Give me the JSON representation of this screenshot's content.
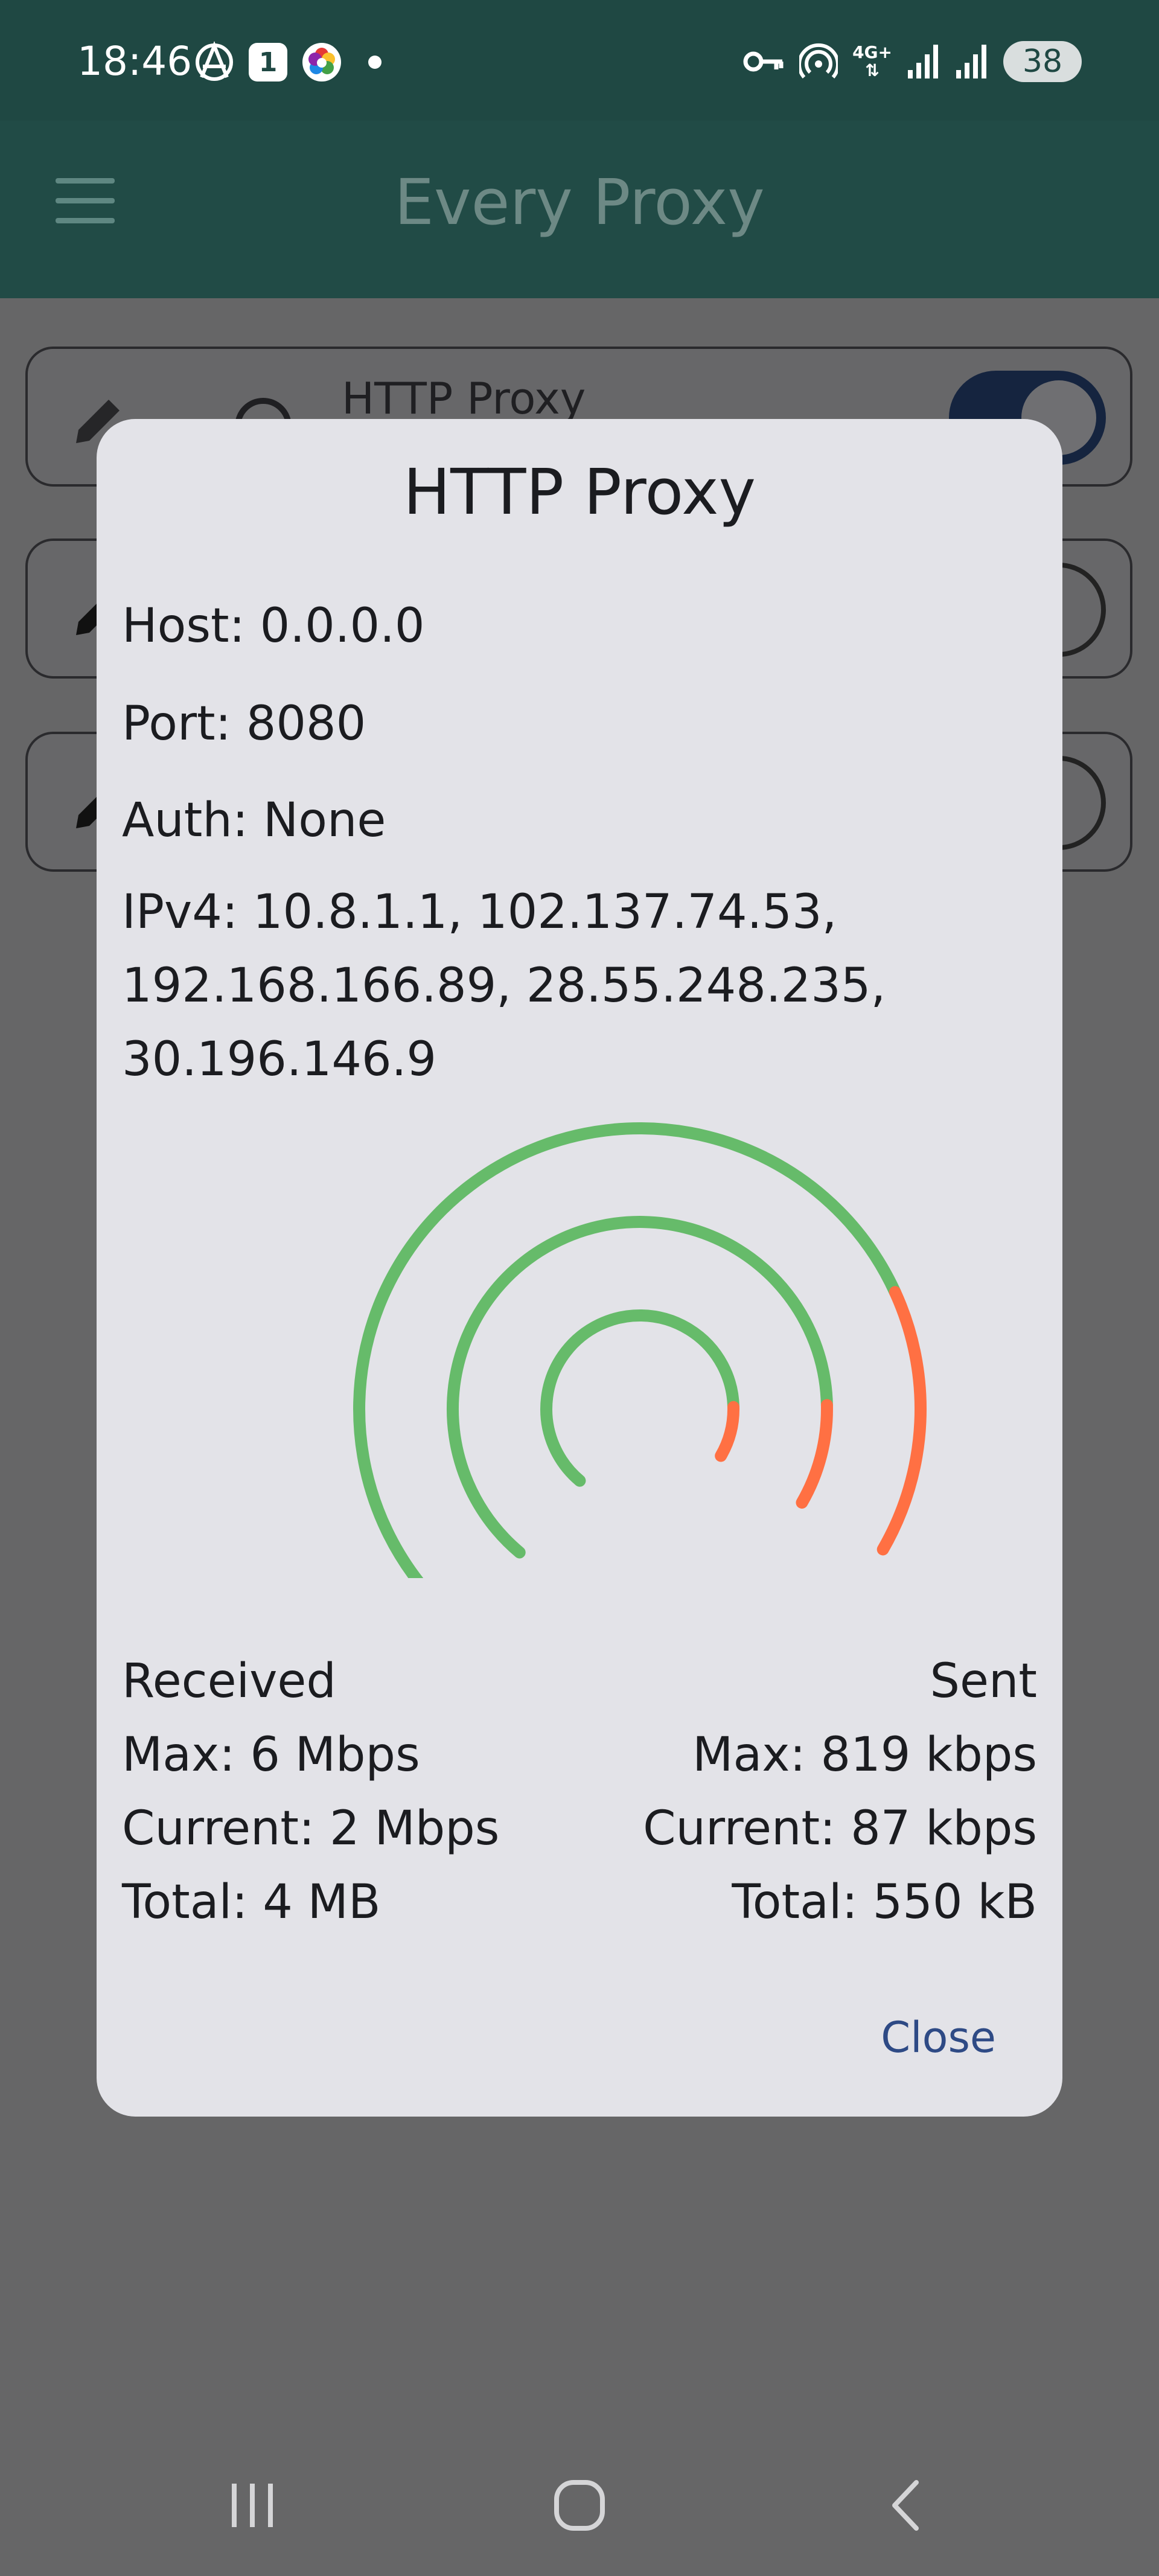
{
  "status_bar": {
    "time": "18:46",
    "notification_count": "1",
    "network": "4G+",
    "battery": "38",
    "icons_left": [
      "anarchy-icon",
      "notification-count-badge",
      "color-hexagon-icon",
      "dot-icon"
    ],
    "icons_right": [
      "vpn-key-icon",
      "hotspot-icon",
      "network-4g-icon",
      "signal-icon",
      "signal-icon",
      "battery-icon"
    ]
  },
  "app_bar": {
    "title": "Every Proxy",
    "menu_icon": "menu-icon"
  },
  "background_list": {
    "items": [
      {
        "label": "HTTP Proxy",
        "toggle_on": true
      },
      {
        "label": "",
        "toggle_on": false
      },
      {
        "label": "",
        "toggle_on": false
      }
    ]
  },
  "dialog": {
    "title": "HTTP Proxy",
    "host": "Host: 0.0.0.0",
    "port": "Port: 8080",
    "auth": "Auth: None",
    "ipv4_line1": "IPv4: 10.8.1.1, 102.137.74.53,",
    "ipv4_line2": "192.168.166.89, 28.55.248.235,",
    "ipv4_line3": "30.196.146.9",
    "gauge": {
      "colors": {
        "track": "#66bb6a",
        "level": "#ff7043"
      },
      "arc_fill_fractions": [
        0.12,
        0.12,
        0.21
      ]
    },
    "received": {
      "heading": "Received",
      "max": "Max: 6 Mbps",
      "current": "Current: 2 Mbps",
      "total": "Total: 4 MB"
    },
    "sent": {
      "heading": "Sent",
      "max": "Max: 819 kbps",
      "current": "Current: 87 kbps",
      "total": "Total: 550 kB"
    },
    "close_label": "Close"
  },
  "nav_bar": {
    "buttons": [
      "recent-apps-icon",
      "home-icon",
      "back-icon"
    ]
  },
  "colors": {
    "status_bar_bg": "#1f4843",
    "app_bar_bg": "#214b46",
    "scrim": "#666667",
    "dialog_bg": "#e3e3e8",
    "accent": "#2e4a85"
  }
}
